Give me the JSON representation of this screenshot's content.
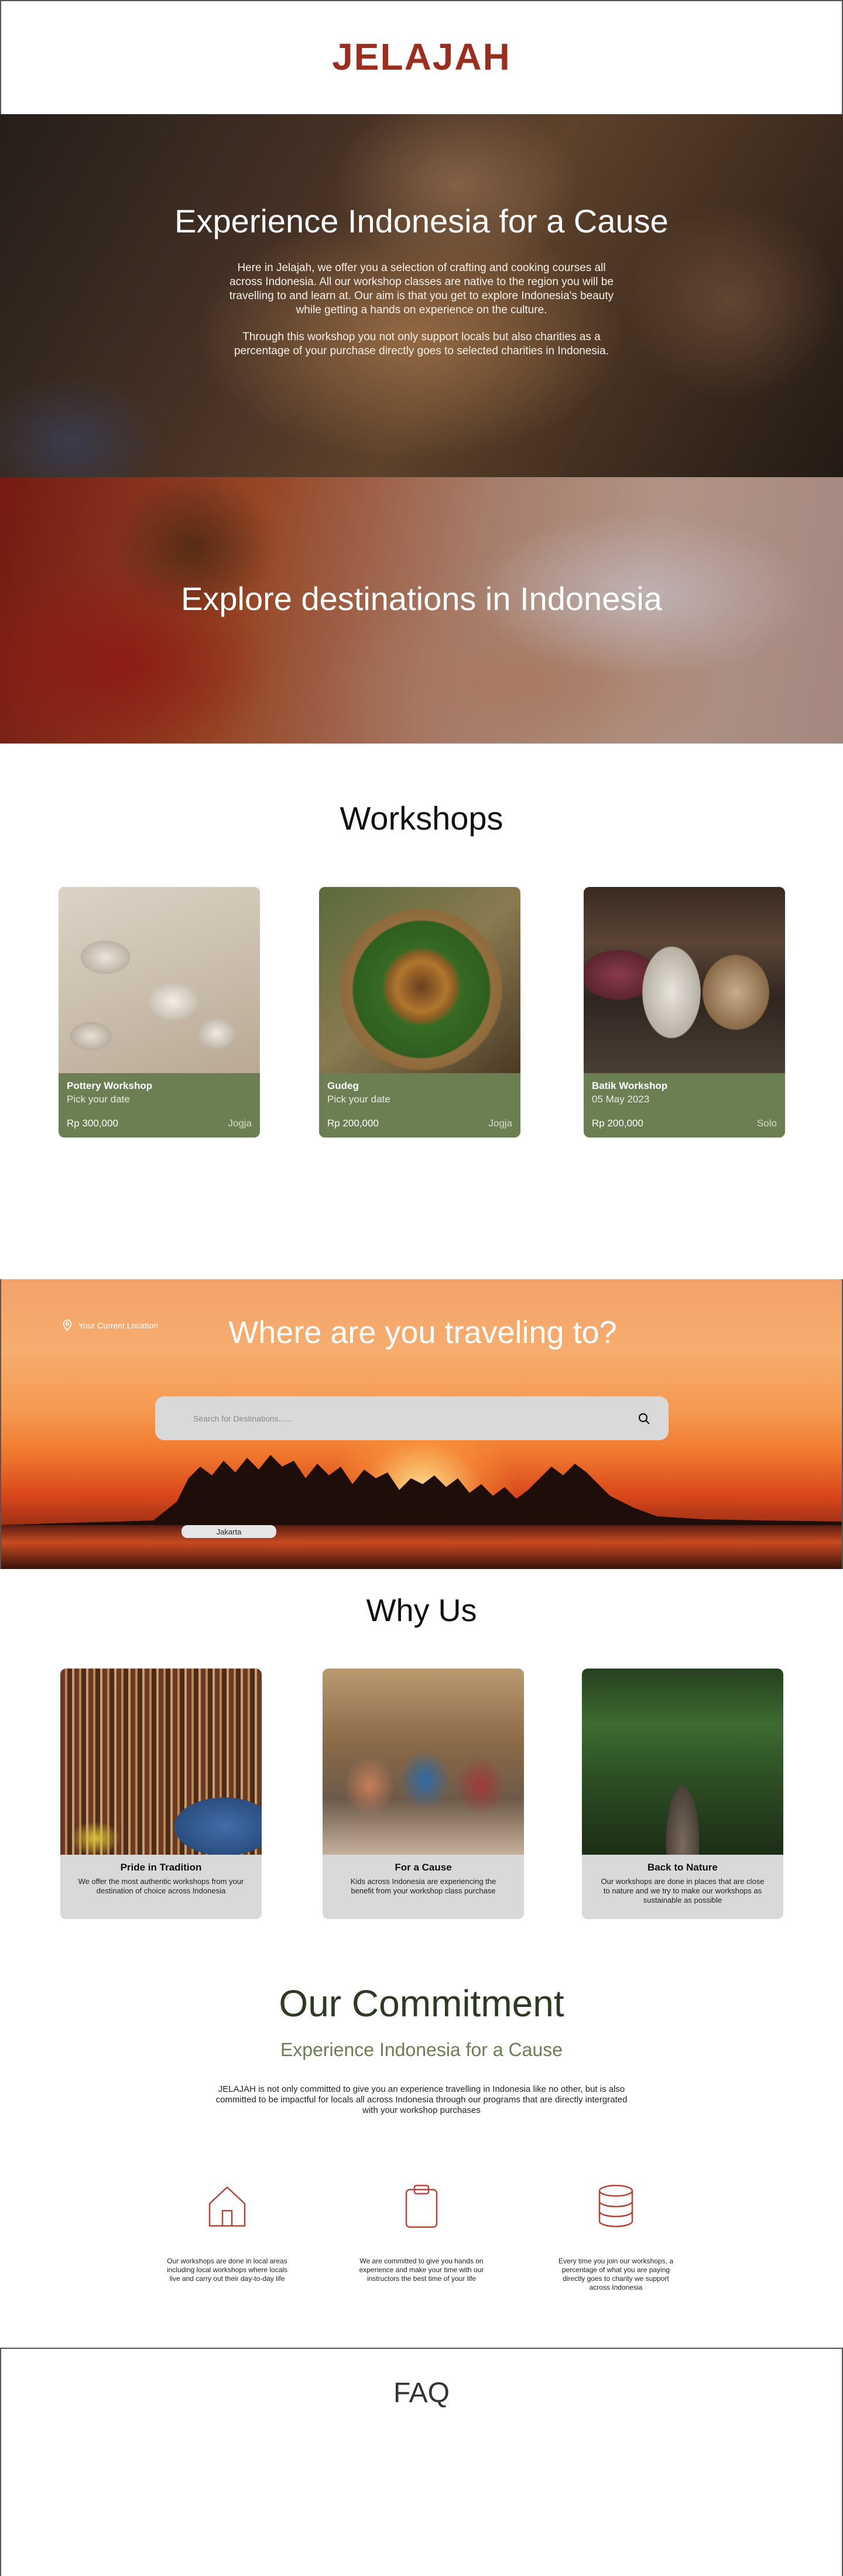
{
  "header": {
    "logo": "JELAJAH"
  },
  "hero": {
    "title": "Experience Indonesia for a Cause",
    "paragraph_1": "Here in Jelajah, we offer you a selection of crafting and cooking courses all across Indonesia. All our workshop classes are native to the region you will be travelling to and learn at.  Our aim is that you get to explore Indonesia's beauty while getting a hands on experience on the culture.",
    "paragraph_2": "Through this workshop you not only support locals but also charities as a percentage of your purchase directly goes to selected charities in Indonesia."
  },
  "explore": {
    "title": "Explore destinations in Indonesia"
  },
  "workshops": {
    "title": "Workshops",
    "cards": [
      {
        "name": "Pottery Workshop",
        "date": "Pick your date",
        "price": "Rp 300,000",
        "location": "Jogja"
      },
      {
        "name": "Gudeg",
        "date": "Pick your date",
        "price": "Rp 200,000",
        "location": "Jogja"
      },
      {
        "name": "Batik Workshop",
        "date": "05 May 2023",
        "price": "Rp 200,000",
        "location": "Solo"
      }
    ]
  },
  "search": {
    "location_label": "Your Current Location",
    "title": "Where are you traveling to?",
    "placeholder": "Search for Destinations......",
    "suggestion": "Jakarta"
  },
  "why_us": {
    "title": "Why Us",
    "cards": [
      {
        "name": "Pride in Tradition",
        "desc": "We offer the most authentic workshops from your destination of choice across Indonesia"
      },
      {
        "name": "For a Cause",
        "desc": "Kids across Indonesia are experiencing the benefit from your workshop class purchase"
      },
      {
        "name": "Back to Nature",
        "desc": "Our workshops are done in places that are close to nature and we try to make our workshops as sustainable as possible"
      }
    ]
  },
  "commitment": {
    "title": "Our Commitment",
    "subtitle": "Experience Indonesia for a Cause",
    "paragraph": "JELAJAH is not only committed to give you an experience travelling in Indonesia like no other, but is also committed to be impactful for locals all across Indonesia through our programs that are directly intergrated with your workshop purchases",
    "items": [
      {
        "icon": "home-icon",
        "text": "Our workshops are done in local areas including local workshops where locals live and carry out their day-to-day life"
      },
      {
        "icon": "clipboard-icon",
        "text": "We are committed to give you hands on experience and make your time with our instructors the best time of your life"
      },
      {
        "icon": "database-icon",
        "text": "Every time you join our workshops, a percentage of what you are paying directly goes to charity we support across Indonesia"
      }
    ]
  },
  "faq": {
    "title": "FAQ"
  },
  "colors": {
    "brand": "#9a2e1f",
    "card_green": "#6b7f52",
    "commit_title": "#2f3a24",
    "icon_red": "#b5443a"
  }
}
